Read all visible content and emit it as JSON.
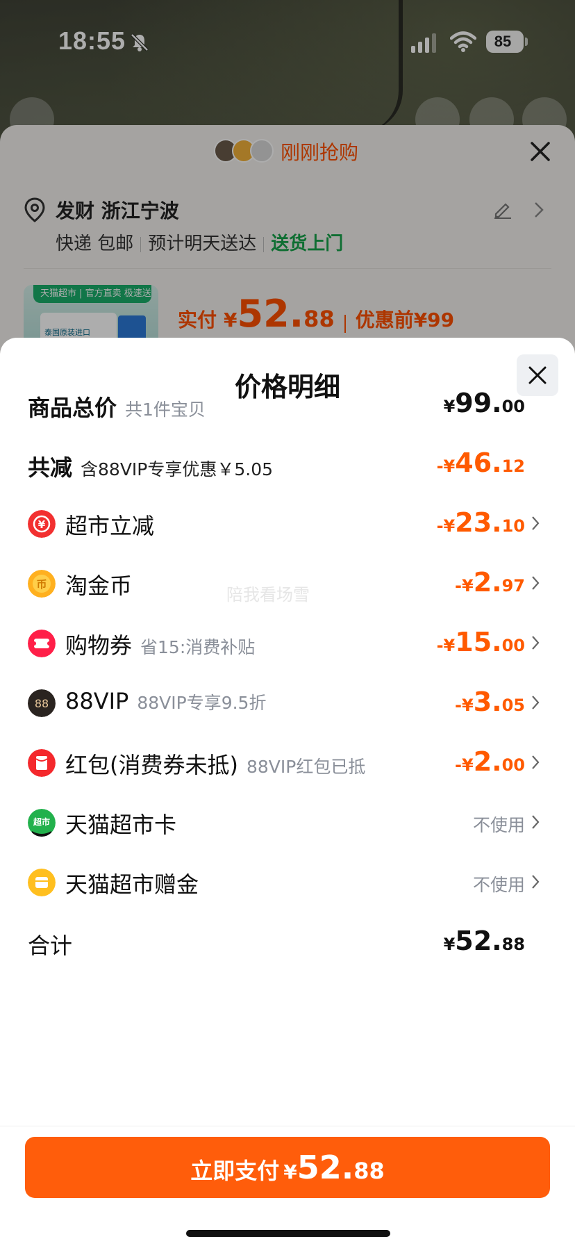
{
  "status_bar": {
    "time": "18:55",
    "battery": "85",
    "icons": [
      "bell-slash-icon",
      "signal-icon",
      "wifi-icon",
      "battery-icon"
    ]
  },
  "background_nav": {
    "icons": [
      "back-icon",
      "share-icon",
      "cart-icon",
      "more-icon"
    ]
  },
  "order_sheet": {
    "header_title": "刚刚抢购",
    "address_name": "发财 浙江宁波",
    "delivery_method": "快递 包邮",
    "delivery_eta": "预计明天送达",
    "delivery_door": "送货上门",
    "product_banner": "天猫超市 | 官方直卖 极速送达",
    "product_caption": "泰国原装进口",
    "actual_pay_label": "实付",
    "actual_pay_currency": "¥",
    "actual_pay_int": "52.",
    "actual_pay_dec": "88",
    "before_discount": "优惠前¥99"
  },
  "detail": {
    "title": "价格明细",
    "rows": [
      {
        "title": "商品总价",
        "sub": "共1件宝贝",
        "cur": "¥",
        "int": "99.",
        "dec": "00"
      },
      {
        "title": "共减",
        "sub": "含88VIP专享优惠￥5.05",
        "cur": "-¥",
        "int": "46.",
        "dec": "12"
      },
      {
        "title": "超市立减",
        "sub": "",
        "cur": "-¥",
        "int": "23.",
        "dec": "10",
        "icon": "supermarket-discount-icon"
      },
      {
        "title": "淘金币",
        "sub": "",
        "cur": "-¥",
        "int": "2.",
        "dec": "97",
        "icon": "taojinbi-coin-icon"
      },
      {
        "title": "购物券",
        "sub": "省15:消费补贴",
        "cur": "-¥",
        "int": "15.",
        "dec": "00",
        "icon": "coupon-icon"
      },
      {
        "title": "88VIP",
        "sub": "88VIP专享9.5折",
        "cur": "-¥",
        "int": "3.",
        "dec": "05",
        "icon": "vip88-icon"
      },
      {
        "title": "红包(消费券未抵)",
        "sub": "88VIP红包已抵",
        "cur": "-¥",
        "int": "2.",
        "dec": "00",
        "icon": "red-packet-icon"
      },
      {
        "title": "天猫超市卡",
        "sub": "",
        "status": "不使用",
        "icon": "tmall-card-icon"
      },
      {
        "title": "天猫超市赠金",
        "sub": "",
        "status": "不使用",
        "icon": "tmall-gift-money-icon"
      },
      {
        "title": "合计",
        "sub": "",
        "cur": "¥",
        "int": "52.",
        "dec": "88"
      }
    ],
    "watermark": "陪我看场雪"
  },
  "pay_button": {
    "label": "立即支付",
    "cur": "¥",
    "int": "52.",
    "dec": "88"
  },
  "colors": {
    "accent_orange": "#ff5d0b",
    "discount_orange": "#ff5a00",
    "green": "#17a34a"
  }
}
